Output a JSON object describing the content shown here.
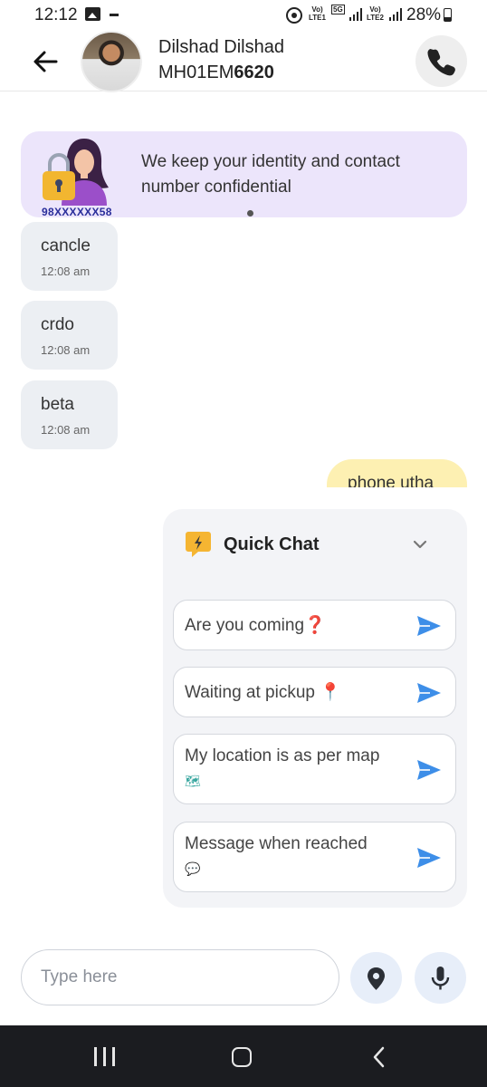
{
  "status_bar": {
    "time": "12:12",
    "sim1_tag_top": "Vo)",
    "sim1_tag_bottom": "LTE1",
    "network_tag_top": "5G",
    "sim2_tag_top": "Vo)",
    "sim2_tag_bottom": "LTE2",
    "battery": "28%",
    "icons": [
      "gallery-icon",
      "minus-icon",
      "hotspot-icon",
      "signal-icon",
      "battery-icon"
    ]
  },
  "header": {
    "contact_name": "Dilshad Dilshad",
    "vehicle_prefix": "MH01EM",
    "vehicle_suffix": "6620"
  },
  "privacy_banner": {
    "text": "We keep your identity and contact number confidential",
    "masked_number": "98XXXXXX58"
  },
  "messages": [
    {
      "text": "cancle",
      "time": "12:08 am",
      "direction": "incoming"
    },
    {
      "text": "crdo",
      "time": "12:08 am",
      "direction": "incoming"
    },
    {
      "text": "beta",
      "time": "12:08 am",
      "direction": "incoming"
    },
    {
      "text": "phone utha",
      "direction": "outgoing"
    }
  ],
  "quick_chat": {
    "title": "Quick Chat",
    "items": [
      {
        "text": "Are you coming",
        "emoji": "❓"
      },
      {
        "text": "Waiting at pickup",
        "emoji": "📍"
      },
      {
        "text": "My location is as per map",
        "emoji": "🗺"
      },
      {
        "text": "Message when reached",
        "emoji": "💬"
      }
    ]
  },
  "composer": {
    "placeholder": "Type here"
  },
  "colors": {
    "banner_bg": "#ece5fb",
    "incoming_bubble": "#eceff3",
    "outgoing_bubble": "#fdf0b2",
    "send_accent": "#3d8ee8",
    "masked_number": "#2a2e9b"
  }
}
